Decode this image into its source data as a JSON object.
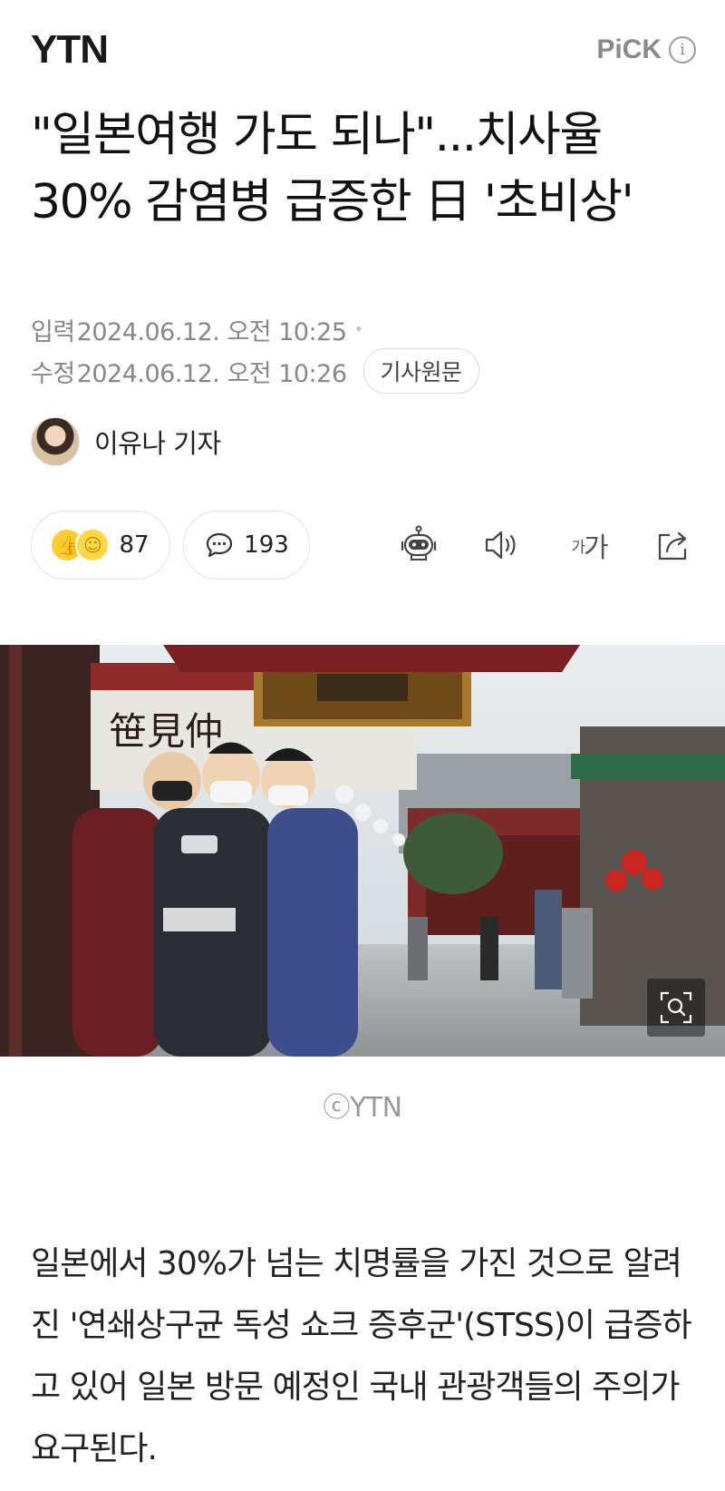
{
  "header": {
    "logo": "YTN",
    "pick_label": "PiCK",
    "info_label": "i"
  },
  "article": {
    "title": "\"일본여행 가도 되나\"...치사율 30% 감염병 급증한 日 '초비상'",
    "input_label": "입력",
    "input_date": "2024.06.12. 오전 10:25",
    "edit_label": "수정",
    "edit_date": "2024.06.12. 오전 10:26",
    "original_button": "기사원문",
    "reporter": "이유나 기자",
    "reaction_count": "87",
    "comment_count": "193",
    "font_tool_small": "가",
    "font_tool_large": "가",
    "photo_credit": "ⓒYTN",
    "body": "일본에서 30%가 넘는 치명률을 가진 것으로 알려진 '연쇄상구균 독성 쇼크 증후군'(STSS)이 급증하고 있어 일본 방문 예정인 국내 관광객들의 주의가 요구된다."
  },
  "photo_sign": "笹見仲",
  "icons": {
    "reaction": "thumbs-up-and-smile-emoji",
    "comment": "speech-bubble-icon",
    "ai_summary": "robot-icon",
    "listen": "speaker-icon",
    "font_size": "font-size-icon",
    "share": "share-icon",
    "zoom": "zoom-icon"
  },
  "colors": {
    "text": "#111111",
    "meta": "#888888",
    "pick": "#8a8a8a",
    "emoji": "#ffcc33"
  }
}
